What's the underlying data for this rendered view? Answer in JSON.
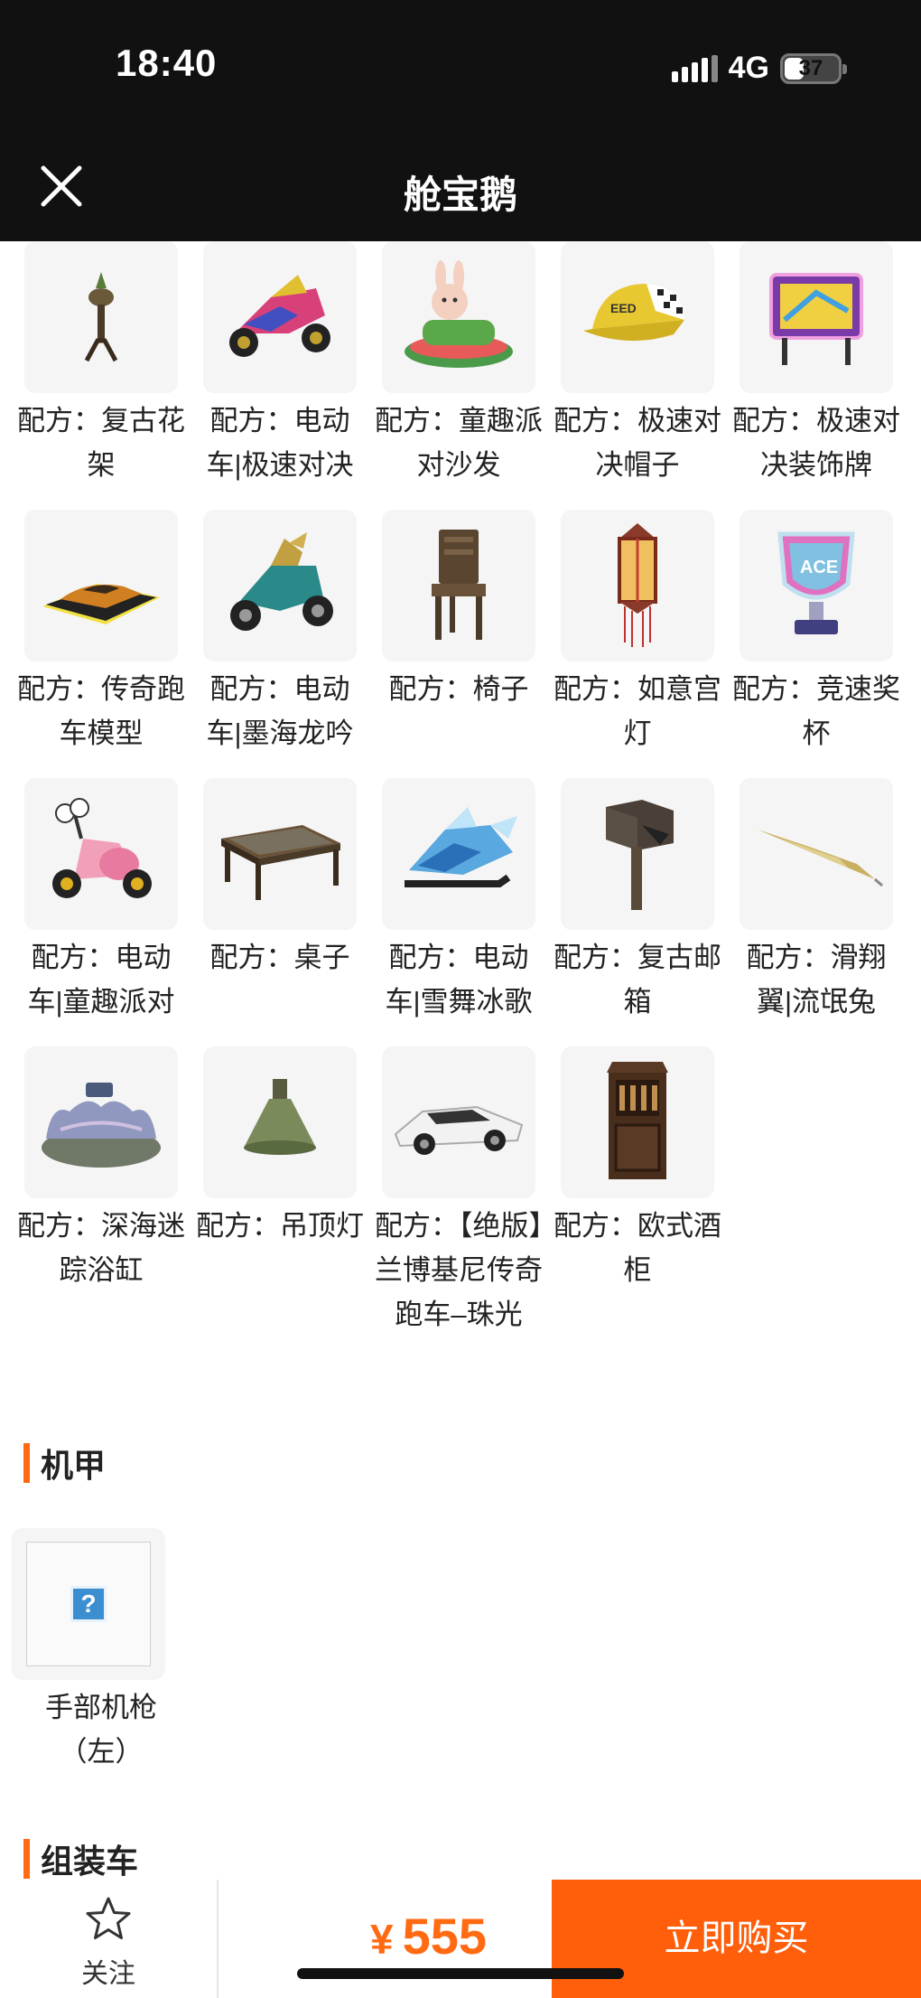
{
  "status_bar": {
    "time": "18:40",
    "network": "4G",
    "battery": "37",
    "battery_level": 0.37
  },
  "nav": {
    "title": "舱宝鹅",
    "close_icon": "close-icon"
  },
  "furniture_items": [
    {
      "label": "配方：复古花架",
      "icon": "vintage-flower-stand"
    },
    {
      "label": "配方：电动车|极速对决",
      "icon": "speed-duel-scooter"
    },
    {
      "label": "配方：童趣派对沙发",
      "icon": "party-sofa"
    },
    {
      "label": "配方：极速对决帽子",
      "icon": "speed-cap"
    },
    {
      "label": "配方：极速对决装饰牌",
      "icon": "speed-sign"
    },
    {
      "label": "配方：传奇跑车模型",
      "icon": "sports-car-model"
    },
    {
      "label": "配方：电动车|墨海龙吟",
      "icon": "dragon-scooter"
    },
    {
      "label": "配方：椅子",
      "icon": "wooden-chair"
    },
    {
      "label": "配方：如意宫灯",
      "icon": "palace-lantern"
    },
    {
      "label": "配方：竞速奖杯",
      "icon": "racing-trophy"
    },
    {
      "label": "配方：电动车|童趣派对",
      "icon": "party-scooter"
    },
    {
      "label": "配方：桌子",
      "icon": "table"
    },
    {
      "label": "配方：电动车|雪舞冰歌",
      "icon": "ice-scooter"
    },
    {
      "label": "配方：复古邮箱",
      "icon": "vintage-mailbox"
    },
    {
      "label": "配方：滑翔翼|流氓兔",
      "icon": "glider"
    },
    {
      "label": "配方：深海迷踪浴缸",
      "icon": "shell-bathtub"
    },
    {
      "label": "配方：吊顶灯",
      "icon": "ceiling-lamp"
    },
    {
      "label": "配方：【绝版】兰博基尼传奇跑车–珠光",
      "icon": "lamborghini-car"
    },
    {
      "label": "配方：欧式酒柜",
      "icon": "wine-cabinet"
    }
  ],
  "sections": {
    "mecha": "机甲",
    "assembly": "组装车"
  },
  "mecha_items": [
    {
      "label": "手部机枪（左）",
      "placeholder": "?"
    }
  ],
  "bottom_bar": {
    "follow_label": "关注",
    "currency": "¥",
    "price": "555",
    "buy_label": "立即购买"
  },
  "colors": {
    "accent": "#ff5e0a",
    "header_bg": "#111111",
    "thumb_bg": "#f5f5f5"
  }
}
